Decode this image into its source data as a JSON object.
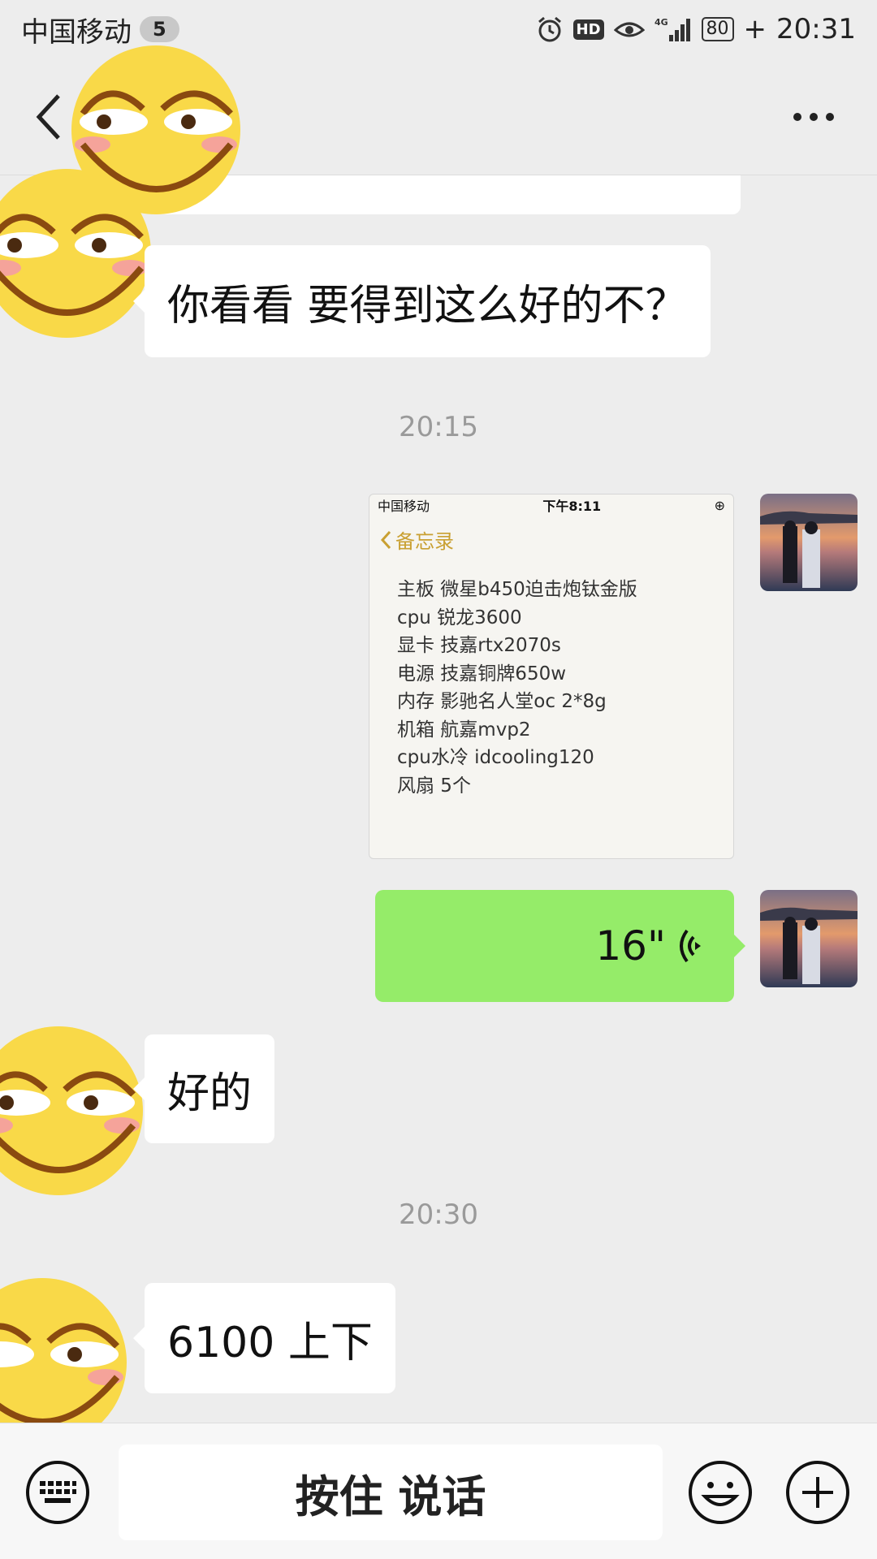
{
  "status_bar": {
    "carrier": "中国移动",
    "sim_badge": "5",
    "network": "4G",
    "battery": "80",
    "time": "20:31"
  },
  "header": {
    "back_icon": "chevron-left-icon",
    "more_icon": "more-dots-icon"
  },
  "messages": [
    {
      "type": "text",
      "from": "other",
      "text": "你看看 要得到这么好的不？"
    },
    {
      "type": "time",
      "text": "20:15"
    },
    {
      "type": "image",
      "from": "me",
      "image": {
        "carrier": "中国移动",
        "time": "下午8:11",
        "back_label": "备忘录",
        "lines": [
          "主板 微星b450迫击炮钛金版",
          "cpu 锐龙3600",
          "显卡 技嘉rtx2070s",
          "电源 技嘉铜牌650w",
          "内存 影驰名人堂oc 2*8g",
          "机箱 航嘉mvp2",
          "cpu水冷 idcooling120",
          "风扇 5个"
        ]
      }
    },
    {
      "type": "voice",
      "from": "me",
      "duration": "16\"",
      "icon": "voice-wave-icon"
    },
    {
      "type": "text",
      "from": "other",
      "text": "好的"
    },
    {
      "type": "time",
      "text": "20:30"
    },
    {
      "type": "text",
      "from": "other",
      "text": "6100 上下"
    }
  ],
  "input_bar": {
    "keyboard_icon": "keyboard-icon",
    "hold_to_talk": "按住 说话",
    "emoji_icon": "emoji-icon",
    "plus_icon": "plus-icon"
  }
}
